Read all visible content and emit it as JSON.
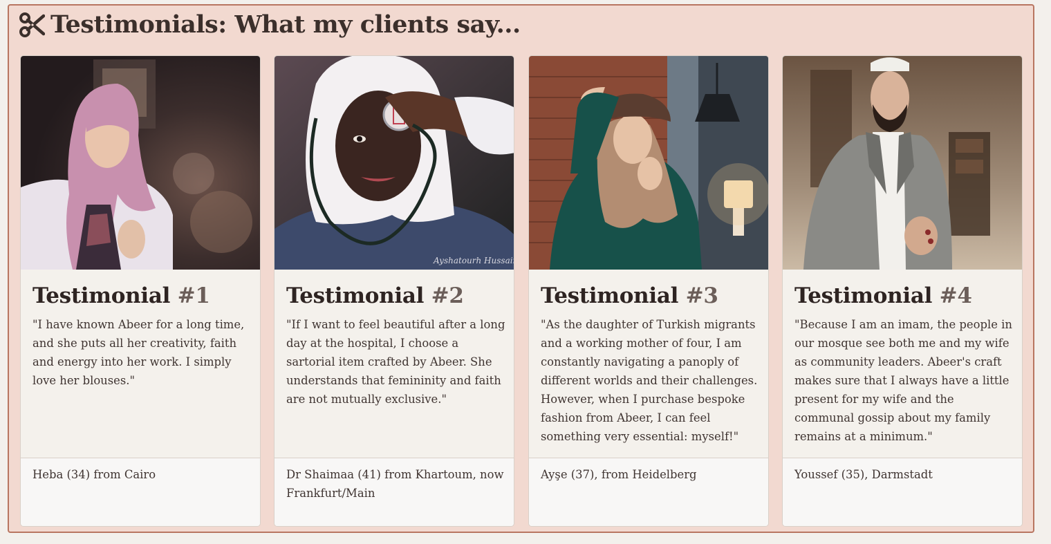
{
  "section": {
    "title": "Testimonials: What my clients say...",
    "icon": "scissors-icon"
  },
  "cards": [
    {
      "title": "Testimonial",
      "number": "#1",
      "quote": "\"I have known Abeer for a long time, and she puts all her creativity, faith and energy into her work. I simply love her blouses.\"",
      "author": "Heba (34) from Cairo",
      "photo_subject": "woman in pink hijab"
    },
    {
      "title": "Testimonial",
      "number": "#2",
      "quote": "\"If I want to feel beautiful after a long day at the hospital, I choose a sartorial item crafted by Abeer. She understands that femininity and faith are not mutually exclusive.\"",
      "author": "Dr Shaimaa (41) from Khartoum, now Frankfurt/Main",
      "photo_subject": "doctor in white hijab with stethoscope"
    },
    {
      "title": "Testimonial",
      "number": "#3",
      "quote": "\"As the daughter of Turkish migrants and a working mother of four, I am constantly navigating a panoply of different worlds and their challenges. However, when I purchase bespoke fashion from Abeer, I can feel something very essential: myself!\"",
      "author": "Ayşe (37), from Heidelberg",
      "photo_subject": "woman in hat and scarf by brick wall"
    },
    {
      "title": "Testimonial",
      "number": "#4",
      "quote": "\"Because I am an imam, the people in our mosque see both me and my wife as community leaders. Abeer's craft makes sure that I always have a little present for my wife and the communal gossip about my family remains at a minimum.\"",
      "author": "Youssef (35), Darmstadt",
      "photo_subject": "man in grey blazer and white cap"
    }
  ],
  "colors": {
    "section_bg": "#f2d9d0",
    "section_border": "#b87560",
    "card_bg": "#f4f1ec",
    "footer_bg": "#f8f7f6",
    "text": "#3b2f2b"
  }
}
